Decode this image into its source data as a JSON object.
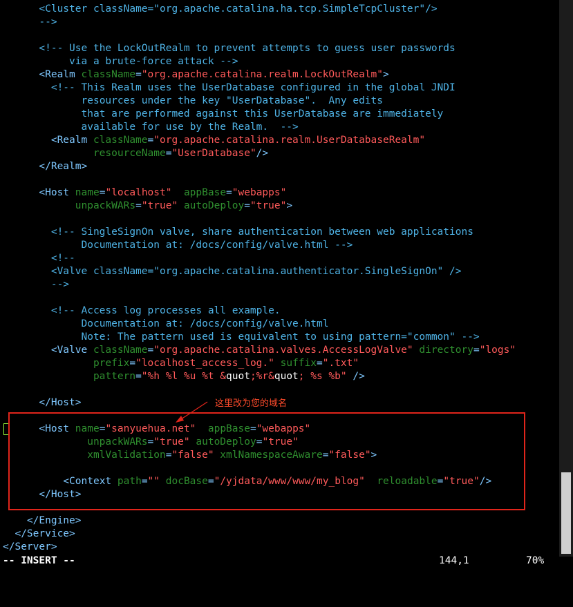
{
  "editor": {
    "lines": [
      [
        [
          "      ",
          "wt"
        ],
        [
          "<Cluster className=\"org.apache.catalina.ha.tcp.SimpleTcpCluster\"/>",
          "cm"
        ]
      ],
      [
        [
          "      ",
          "wt"
        ],
        [
          "-->",
          "cm"
        ]
      ],
      [
        [
          "",
          ""
        ]
      ],
      [
        [
          "      ",
          "wt"
        ],
        [
          "<!-- Use the LockOutRealm to prevent attempts to guess user passwords",
          "cm"
        ]
      ],
      [
        [
          "           ",
          "wt"
        ],
        [
          "via a brute-force attack -->",
          "cm"
        ]
      ],
      [
        [
          "      ",
          "wt"
        ],
        [
          "<Realm ",
          "tg"
        ],
        [
          "className",
          "at"
        ],
        [
          "=",
          "op"
        ],
        [
          "\"org.apache.catalina.realm.LockOutRealm\"",
          "st"
        ],
        [
          ">",
          "tg"
        ]
      ],
      [
        [
          "        ",
          "wt"
        ],
        [
          "<!-- This Realm uses the UserDatabase configured in the global JNDI",
          "cm"
        ]
      ],
      [
        [
          "             ",
          "wt"
        ],
        [
          "resources under the key \"UserDatabase\".  Any edits",
          "cm"
        ]
      ],
      [
        [
          "             ",
          "wt"
        ],
        [
          "that are performed against this UserDatabase are immediately",
          "cm"
        ]
      ],
      [
        [
          "             ",
          "wt"
        ],
        [
          "available for use by the Realm.  -->",
          "cm"
        ]
      ],
      [
        [
          "        ",
          "wt"
        ],
        [
          "<Realm ",
          "tg"
        ],
        [
          "className",
          "at"
        ],
        [
          "=",
          "op"
        ],
        [
          "\"org.apache.catalina.realm.UserDatabaseRealm\"",
          "st"
        ]
      ],
      [
        [
          "               ",
          "wt"
        ],
        [
          "resourceName",
          "at"
        ],
        [
          "=",
          "op"
        ],
        [
          "\"UserDatabase\"",
          "st"
        ],
        [
          "/>",
          "tg"
        ]
      ],
      [
        [
          "      ",
          "wt"
        ],
        [
          "</Realm>",
          "tg"
        ]
      ],
      [
        [
          "",
          ""
        ]
      ],
      [
        [
          "      ",
          "wt"
        ],
        [
          "<Host ",
          "tg"
        ],
        [
          "name",
          "at"
        ],
        [
          "=",
          "op"
        ],
        [
          "\"localhost\"",
          "st"
        ],
        [
          "  ",
          "wt"
        ],
        [
          "appBase",
          "at"
        ],
        [
          "=",
          "op"
        ],
        [
          "\"webapps\"",
          "st"
        ]
      ],
      [
        [
          "            ",
          "wt"
        ],
        [
          "unpackWARs",
          "at"
        ],
        [
          "=",
          "op"
        ],
        [
          "\"true\"",
          "st"
        ],
        [
          " ",
          "wt"
        ],
        [
          "autoDeploy",
          "at"
        ],
        [
          "=",
          "op"
        ],
        [
          "\"true\"",
          "st"
        ],
        [
          ">",
          "tg"
        ]
      ],
      [
        [
          "",
          ""
        ]
      ],
      [
        [
          "        ",
          "wt"
        ],
        [
          "<!-- SingleSignOn valve, share authentication between web applications",
          "cm"
        ]
      ],
      [
        [
          "             ",
          "wt"
        ],
        [
          "Documentation at: /docs/config/valve.html -->",
          "cm"
        ]
      ],
      [
        [
          "        ",
          "wt"
        ],
        [
          "<!--",
          "cm"
        ]
      ],
      [
        [
          "        ",
          "wt"
        ],
        [
          "<Valve className=\"org.apache.catalina.authenticator.SingleSignOn\" />",
          "cm"
        ]
      ],
      [
        [
          "        ",
          "wt"
        ],
        [
          "-->",
          "cm"
        ]
      ],
      [
        [
          "",
          ""
        ]
      ],
      [
        [
          "        ",
          "wt"
        ],
        [
          "<!-- Access log processes all example.",
          "cm"
        ]
      ],
      [
        [
          "             ",
          "wt"
        ],
        [
          "Documentation at: /docs/config/valve.html",
          "cm"
        ]
      ],
      [
        [
          "             ",
          "wt"
        ],
        [
          "Note: The pattern used is equivalent to using pattern=\"common\" -->",
          "cm"
        ]
      ],
      [
        [
          "        ",
          "wt"
        ],
        [
          "<Valve ",
          "tg"
        ],
        [
          "className",
          "at"
        ],
        [
          "=",
          "op"
        ],
        [
          "\"org.apache.catalina.valves.AccessLogValve\"",
          "st"
        ],
        [
          " ",
          "wt"
        ],
        [
          "directory",
          "at"
        ],
        [
          "=",
          "op"
        ],
        [
          "\"logs\"",
          "st"
        ]
      ],
      [
        [
          "               ",
          "wt"
        ],
        [
          "prefix",
          "at"
        ],
        [
          "=",
          "op"
        ],
        [
          "\"localhost_access_log.\"",
          "st"
        ],
        [
          " ",
          "wt"
        ],
        [
          "suffix",
          "at"
        ],
        [
          "=",
          "op"
        ],
        [
          "\".txt\"",
          "st"
        ]
      ],
      [
        [
          "               ",
          "wt"
        ],
        [
          "pattern",
          "at"
        ],
        [
          "=",
          "op"
        ],
        [
          "\"%h %l %u %t &",
          "st"
        ],
        [
          "quot",
          "wt"
        ],
        [
          ";%r&",
          "st"
        ],
        [
          "quot",
          "wt"
        ],
        [
          "; %s %b\"",
          "st"
        ],
        [
          " />",
          "tg"
        ]
      ],
      [
        [
          "",
          ""
        ]
      ],
      [
        [
          "      ",
          "wt"
        ],
        [
          "</Host>",
          "tg"
        ]
      ],
      [
        [
          "",
          ""
        ]
      ],
      [
        [
          "      ",
          "wt"
        ],
        [
          "<Host ",
          "tg"
        ],
        [
          "name",
          "at"
        ],
        [
          "=",
          "op"
        ],
        [
          "\"sanyuehua.net\"",
          "st"
        ],
        [
          "  ",
          "wt"
        ],
        [
          "appBase",
          "at"
        ],
        [
          "=",
          "op"
        ],
        [
          "\"webapps\"",
          "st"
        ]
      ],
      [
        [
          "              ",
          "wt"
        ],
        [
          "unpackWARs",
          "at"
        ],
        [
          "=",
          "op"
        ],
        [
          "\"true\"",
          "st"
        ],
        [
          " ",
          "wt"
        ],
        [
          "autoDeploy",
          "at"
        ],
        [
          "=",
          "op"
        ],
        [
          "\"true\"",
          "st"
        ]
      ],
      [
        [
          "              ",
          "wt"
        ],
        [
          "xmlValidation",
          "at"
        ],
        [
          "=",
          "op"
        ],
        [
          "\"false\"",
          "st"
        ],
        [
          " ",
          "wt"
        ],
        [
          "xmlNamespaceAware",
          "at"
        ],
        [
          "=",
          "op"
        ],
        [
          "\"false\"",
          "st"
        ],
        [
          ">",
          "tg"
        ]
      ],
      [
        [
          "",
          ""
        ]
      ],
      [
        [
          "          ",
          "wt"
        ],
        [
          "<Context ",
          "tg"
        ],
        [
          "path",
          "at"
        ],
        [
          "=",
          "op"
        ],
        [
          "\"\"",
          "st"
        ],
        [
          " ",
          "wt"
        ],
        [
          "docBase",
          "at"
        ],
        [
          "=",
          "op"
        ],
        [
          "\"/yjdata/www/www/my_blog\"",
          "st"
        ],
        [
          "  ",
          "wt"
        ],
        [
          "reloadable",
          "at"
        ],
        [
          "=",
          "op"
        ],
        [
          "\"true\"",
          "st"
        ],
        [
          "/>",
          "tg"
        ]
      ],
      [
        [
          "      ",
          "wt"
        ],
        [
          "</Host>",
          "tg"
        ]
      ],
      [
        [
          "",
          ""
        ]
      ],
      [
        [
          "    ",
          "wt"
        ],
        [
          "</Engine>",
          "tg"
        ]
      ],
      [
        [
          "  ",
          "wt"
        ],
        [
          "</Service>",
          "tg"
        ]
      ],
      [
        [
          "",
          "wt"
        ],
        [
          "</Server>",
          "tg"
        ]
      ]
    ]
  },
  "annotation": {
    "text": "这里改为您的域名",
    "color": "#e1251b"
  },
  "status": {
    "mode": "-- INSERT --",
    "position": "144,1",
    "percent": "70%"
  },
  "scroll": {
    "fraction": 0.7
  }
}
